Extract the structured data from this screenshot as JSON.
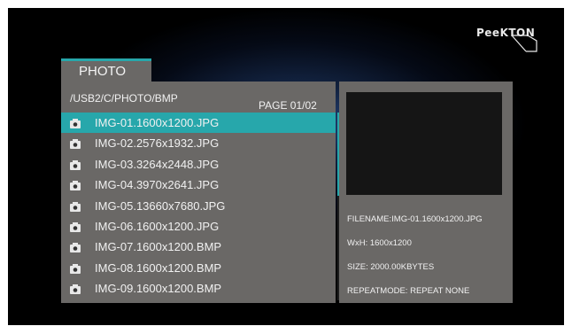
{
  "brand": {
    "logo_text": "PeeKTON"
  },
  "tab": {
    "label": "PHOTO"
  },
  "browser": {
    "path": "/USB2/C/PHOTO/BMP",
    "page_indicator": "PAGE 01/02",
    "files": [
      "IMG-01.1600x1200.JPG",
      "IMG-02.2576x1932.JPG",
      "IMG-03.3264x2448.JPG",
      "IMG-04.3970x2641.JPG",
      "IMG-05.13660x7680.JPG",
      "IMG-06.1600x1200.JPG",
      "IMG-07.1600x1200.BMP",
      "IMG-08.1600x1200.BMP",
      "IMG-09.1600x1200.BMP"
    ],
    "selected_index": 0,
    "file_icon": "camera-icon"
  },
  "info": {
    "filename": "FILENAME:IMG-01.1600x1200.JPG",
    "dimensions": "WxH:  1600x1200",
    "size": "SIZE:  2000.00KBYTES",
    "repeat_mode": "REPEATMODE: REPEAT NONE"
  },
  "colors": {
    "accent": "#27a7ab",
    "panel": "#6a6866",
    "background": "#000000",
    "text": "#f1f1f1"
  }
}
